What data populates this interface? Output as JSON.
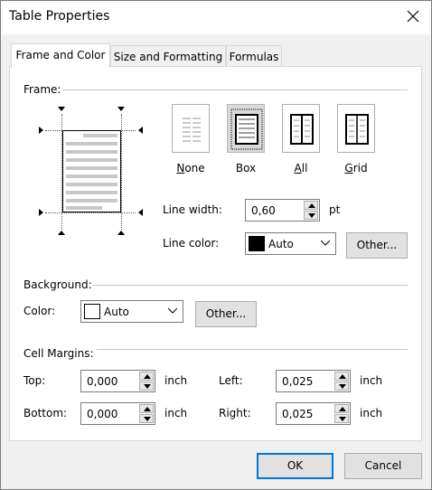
{
  "window": {
    "title": "Table Properties"
  },
  "tabs": [
    {
      "label": "Frame and Color"
    },
    {
      "label": "Size and Formatting"
    },
    {
      "label": "Formulas"
    }
  ],
  "frame": {
    "group_label": "Frame:",
    "styles": [
      {
        "label": "None",
        "mnemonic": "N",
        "rest": "one"
      },
      {
        "label": "Box",
        "selected": true
      },
      {
        "label": "All",
        "mnemonic": "A",
        "rest": "ll"
      },
      {
        "label": "Grid",
        "mnemonic": "G",
        "rest": "rid"
      }
    ],
    "line_width_label": "Line width:",
    "line_width_value": "0,60",
    "line_width_unit": "pt",
    "line_color_label": "Line color:",
    "line_color_value": "Auto",
    "line_color_swatch": "#000000",
    "other_button": "Other..."
  },
  "background": {
    "group_label": "Background:",
    "color_label": "Color:",
    "color_value": "Auto",
    "color_swatch": "#ffffff",
    "other_button": "Other..."
  },
  "cell_margins": {
    "group_label": "Cell Margins:",
    "top_label": "Top:",
    "top_value": "0,000",
    "bottom_label": "Bottom:",
    "bottom_value": "0,000",
    "left_label": "Left:",
    "left_value": "0,025",
    "right_label": "Right:",
    "right_value": "0,025",
    "unit": "inch"
  },
  "buttons": {
    "ok": "OK",
    "cancel": "Cancel"
  },
  "colors": {
    "accent": "#0078d7"
  }
}
